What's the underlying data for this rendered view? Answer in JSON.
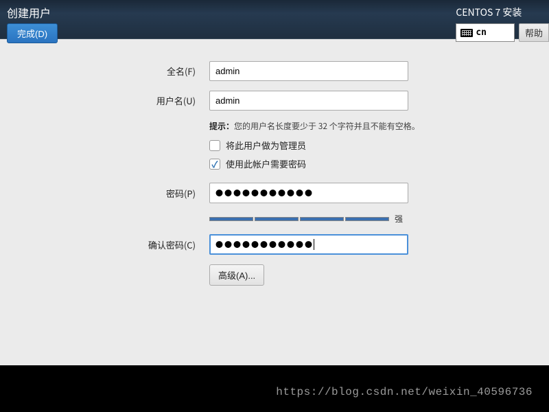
{
  "header": {
    "page_title": "创建用户",
    "done_label": "完成(D)",
    "installer_title": "CENTOS 7 安装",
    "lang_code": "cn",
    "help_label": "帮助"
  },
  "form": {
    "fullname_label": "全名(F)",
    "fullname_value": "admin",
    "username_label": "用户名(U)",
    "username_value": "admin",
    "hint_prefix": "提示：",
    "hint_text": "您的用户名长度要少于 32 个字符并且不能有空格。",
    "admin_checkbox_label": "将此用户做为管理员",
    "admin_checkbox_checked": false,
    "password_req_label": "使用此帐户需要密码",
    "password_req_checked": true,
    "password_label": "密码(P)",
    "password_value": "●●●●●●●●●●●",
    "strength_label": "强",
    "confirm_label": "确认密码(C)",
    "confirm_value": "●●●●●●●●●●●",
    "advanced_label": "高级(A)..."
  },
  "footer": {
    "watermark": "https://blog.csdn.net/weixin_40596736"
  }
}
